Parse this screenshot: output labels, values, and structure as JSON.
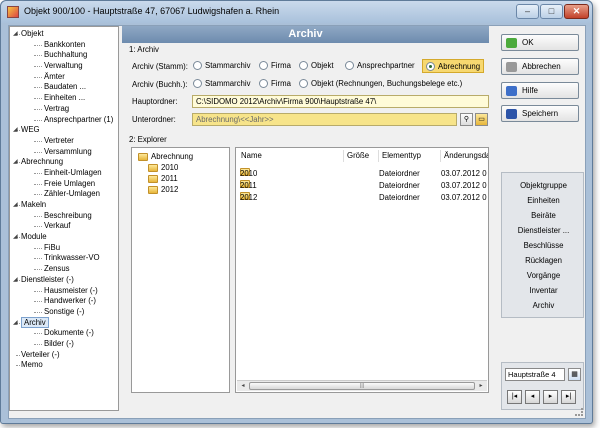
{
  "window": {
    "title": "Objekt 900/100 - Hauptstraße 47, 67067 Ludwigshafen a. Rhein"
  },
  "tree": [
    {
      "label": "Objekt",
      "level": 0,
      "expanded": true
    },
    {
      "label": "Bankkonten",
      "level": 1
    },
    {
      "label": "Buchhaltung",
      "level": 1
    },
    {
      "label": "Verwaltung",
      "level": 1
    },
    {
      "label": "Ämter",
      "level": 1
    },
    {
      "label": "Baudaten ...",
      "level": 1
    },
    {
      "label": "Einheiten ...",
      "level": 1
    },
    {
      "label": "Vertrag",
      "level": 1
    },
    {
      "label": "Ansprechpartner (1)",
      "level": 1
    },
    {
      "label": "WEG",
      "level": 0,
      "expanded": true
    },
    {
      "label": "Vertreter",
      "level": 1
    },
    {
      "label": "Versammlung",
      "level": 1
    },
    {
      "label": "Abrechnung",
      "level": 0,
      "expanded": true
    },
    {
      "label": "Einheit-Umlagen",
      "level": 1
    },
    {
      "label": "Freie Umlagen",
      "level": 1
    },
    {
      "label": "Zähler-Umlagen",
      "level": 1
    },
    {
      "label": "Makeln",
      "level": 0,
      "expanded": true
    },
    {
      "label": "Beschreibung",
      "level": 1
    },
    {
      "label": "Verkauf",
      "level": 1
    },
    {
      "label": "Module",
      "level": 0,
      "expanded": true
    },
    {
      "label": "FiBu",
      "level": 1
    },
    {
      "label": "Trinkwasser-VO",
      "level": 1
    },
    {
      "label": "Zensus",
      "level": 1
    },
    {
      "label": "Dienstleister (-)",
      "level": 0,
      "expanded": true
    },
    {
      "label": "Hausmeister (-)",
      "level": 1
    },
    {
      "label": "Handwerker (-)",
      "level": 1
    },
    {
      "label": "Sonstige (-)",
      "level": 1
    },
    {
      "label": "Archiv",
      "level": 0,
      "expanded": true,
      "selected": true
    },
    {
      "label": "Dokumente (-)",
      "level": 1
    },
    {
      "label": "Bilder (-)",
      "level": 1
    },
    {
      "label": "Verteiler (-)",
      "level": 0
    },
    {
      "label": "Memo",
      "level": 0
    }
  ],
  "header": {
    "title": "Archiv"
  },
  "archiv": {
    "group_label": "1: Archiv",
    "stamm_label": "Archiv (Stamm):",
    "stamm_options": [
      "Stammarchiv",
      "Firma",
      "Objekt",
      "Ansprechpartner",
      "Abrechnung"
    ],
    "buchh_label": "Archiv (Buchh.):",
    "buchh_options": [
      "Stammarchiv",
      "Firma",
      "Objekt (Rechnungen, Buchungsbelege etc.)"
    ],
    "hauptordner_label": "Hauptordner:",
    "hauptordner_value": "C:\\SIDOMO 2012\\Archiv\\Firma 900\\Hauptstraße 47\\",
    "unterordner_label": "Unterordner:",
    "unterordner_value": "Abrechnung\\<<Jahr>>"
  },
  "explorer": {
    "group_label": "2: Explorer",
    "folders": [
      "Abrechnung",
      "2010",
      "2011",
      "2012"
    ],
    "columns": [
      "Name",
      "Größe",
      "Elementtyp",
      "Änderungsda"
    ],
    "files": [
      {
        "name": "2010",
        "size": "",
        "type": "Dateiordner",
        "date": "03.07.2012 0"
      },
      {
        "name": "2011",
        "size": "",
        "type": "Dateiordner",
        "date": "03.07.2012 0"
      },
      {
        "name": "2012",
        "size": "",
        "type": "Dateiordner",
        "date": "03.07.2012 0"
      }
    ]
  },
  "actions": {
    "ok": "OK",
    "abbrechen": "Abbrechen",
    "hilfe": "Hilfe",
    "speichern": "Speichern"
  },
  "nav_items": [
    "Objektgruppe",
    "Einheiten",
    "Beiräte",
    "Dienstleister ...",
    "Beschlüsse",
    "Rücklagen",
    "Vorgänge",
    "Inventar",
    "Archiv"
  ],
  "combo": {
    "value": "Hauptstraße 4"
  },
  "colors": {
    "header": "#7b97b8",
    "highlight": "#f7d870",
    "field_yellow": "#fffbd8"
  }
}
